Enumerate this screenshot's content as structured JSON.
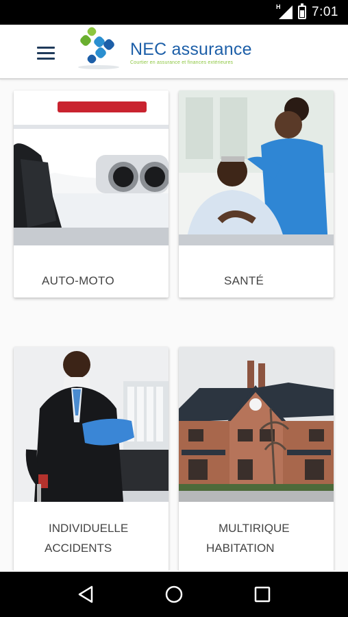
{
  "status_bar": {
    "time": "7:01",
    "network_indicator": "H",
    "icons": [
      "signal-icon",
      "battery-charging-icon"
    ]
  },
  "app_bar": {
    "menu_icon": "hamburger-menu-icon",
    "brand_name": "NEC assurance",
    "brand_tagline": "Courtier en assurance et finances extérieures",
    "colors": {
      "brand_blue": "#1d5fa8",
      "brand_green": "#8cc63f"
    }
  },
  "categories": [
    {
      "label": "AUTO-MOTO",
      "image": "car-exhaust-photo"
    },
    {
      "label": "SANTÉ",
      "image": "nurse-and-patient-photo"
    },
    {
      "label_line1": "INDIVIDUELLE",
      "label_line2": "ACCIDENTS",
      "image": "injured-man-photo"
    },
    {
      "label_line1": "MULTIRIQUE",
      "label_line2": "HABITATION",
      "image": "brick-house-photo"
    }
  ],
  "nav_bar": {
    "icons": [
      "back-icon",
      "home-icon",
      "recents-icon"
    ]
  }
}
